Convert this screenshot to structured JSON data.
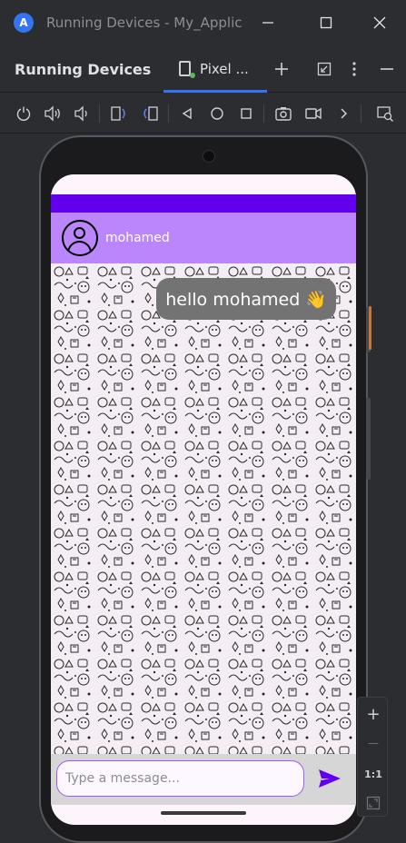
{
  "window": {
    "title": "Running Devices - My_Applic",
    "logo": "android-studio-icon"
  },
  "tool_window": {
    "title": "Running Devices",
    "tab_label": "Pixel ...",
    "add_tooltip": "+",
    "colors": {
      "accent": "#3574f0",
      "online": "#5fb865"
    }
  },
  "toolbar": {
    "icons": [
      "power-icon",
      "volume-up-icon",
      "volume-down-icon",
      "rotate-left-icon",
      "rotate-right-icon",
      "back-icon",
      "home-icon",
      "overview-icon",
      "screenshot-icon",
      "screen-record-icon",
      "more-icon",
      "device-explorer-icon"
    ]
  },
  "app": {
    "contact_name": "mohamed",
    "message_text": "hello mohamed 👋",
    "input_placeholder": "Type a message...",
    "colors": {
      "status_strip": "#6200ee",
      "header": "#bb86fc",
      "bubble": "#737373",
      "send": "#6200ee"
    }
  },
  "zoom": {
    "plus": "+",
    "minus": "—",
    "actual_size": "1:1"
  }
}
